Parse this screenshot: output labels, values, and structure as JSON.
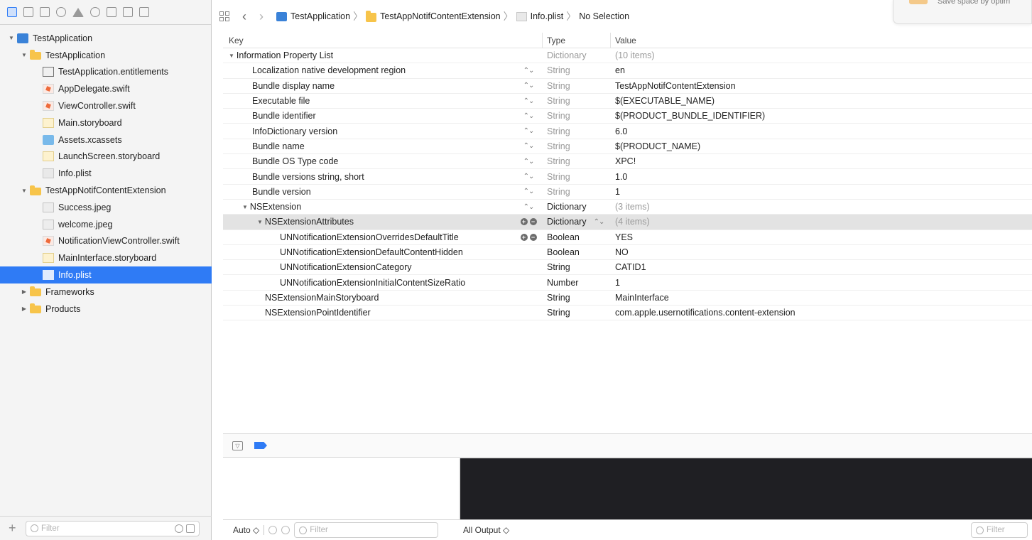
{
  "navigator": {
    "toolbar_icons": [
      "folder-icon",
      "source-control-icon",
      "symbol-icon",
      "find-icon",
      "issue-icon",
      "test-icon",
      "debug-icon",
      "breakpoint-icon",
      "report-icon"
    ],
    "filter_placeholder": "Filter",
    "tree": [
      {
        "label": "TestApplication",
        "icon": "project-icon"
      },
      {
        "label": "TestApplication",
        "icon": "folder-icon"
      },
      {
        "label": "TestApplication.entitlements",
        "icon": "entitlements-icon"
      },
      {
        "label": "AppDelegate.swift",
        "icon": "swift-file-icon"
      },
      {
        "label": "ViewController.swift",
        "icon": "swift-file-icon"
      },
      {
        "label": "Main.storyboard",
        "icon": "storyboard-icon"
      },
      {
        "label": "Assets.xcassets",
        "icon": "assets-icon"
      },
      {
        "label": "LaunchScreen.storyboard",
        "icon": "storyboard-icon"
      },
      {
        "label": "Info.plist",
        "icon": "plist-icon"
      },
      {
        "label": "TestAppNotifContentExtension",
        "icon": "folder-icon"
      },
      {
        "label": "Success.jpeg",
        "icon": "image-file-icon"
      },
      {
        "label": "welcome.jpeg",
        "icon": "image-file-icon"
      },
      {
        "label": "NotificationViewController.swift",
        "icon": "swift-file-icon"
      },
      {
        "label": "MainInterface.storyboard",
        "icon": "storyboard-icon"
      },
      {
        "label": "Info.plist",
        "icon": "plist-icon",
        "selected": true
      },
      {
        "label": "Frameworks",
        "icon": "folder-icon"
      },
      {
        "label": "Products",
        "icon": "folder-icon"
      }
    ]
  },
  "jumpbar": {
    "crumbs": [
      "TestApplication",
      "TestAppNotifContentExtension",
      "Info.plist",
      "No Selection"
    ]
  },
  "notification": {
    "text": "Save space by optim"
  },
  "plist": {
    "headers": {
      "key": "Key",
      "type": "Type",
      "value": "Value"
    },
    "rows": [
      {
        "key": "Information Property List",
        "type": "Dictionary",
        "value": "(10 items)"
      },
      {
        "key": "Localization native development region",
        "type": "String",
        "value": "en"
      },
      {
        "key": "Bundle display name",
        "type": "String",
        "value": "TestAppNotifContentExtension"
      },
      {
        "key": "Executable file",
        "type": "String",
        "value": "$(EXECUTABLE_NAME)"
      },
      {
        "key": "Bundle identifier",
        "type": "String",
        "value": "$(PRODUCT_BUNDLE_IDENTIFIER)"
      },
      {
        "key": "InfoDictionary version",
        "type": "String",
        "value": "6.0"
      },
      {
        "key": "Bundle name",
        "type": "String",
        "value": "$(PRODUCT_NAME)"
      },
      {
        "key": "Bundle OS Type code",
        "type": "String",
        "value": "XPC!"
      },
      {
        "key": "Bundle versions string, short",
        "type": "String",
        "value": "1.0"
      },
      {
        "key": "Bundle version",
        "type": "String",
        "value": "1"
      },
      {
        "key": "NSExtension",
        "type": "Dictionary",
        "value": "(3 items)"
      },
      {
        "key": "NSExtensionAttributes",
        "type": "Dictionary",
        "value": "(4 items)"
      },
      {
        "key": "UNNotificationExtensionOverridesDefaultTitle",
        "type": "Boolean",
        "value": "YES"
      },
      {
        "key": "UNNotificationExtensionDefaultContentHidden",
        "type": "Boolean",
        "value": "NO"
      },
      {
        "key": "UNNotificationExtensionCategory",
        "type": "String",
        "value": "CATID1"
      },
      {
        "key": "UNNotificationExtensionInitialContentSizeRatio",
        "type": "Number",
        "value": "1"
      },
      {
        "key": "NSExtensionMainStoryboard",
        "type": "String",
        "value": "MainInterface"
      },
      {
        "key": "NSExtensionPointIdentifier",
        "type": "String",
        "value": "com.apple.usernotifications.content-extension"
      }
    ]
  },
  "debug": {
    "auto_label": "Auto ◇",
    "filter_placeholder": "Filter",
    "output_label": "All Output ◇",
    "right_filter_placeholder": "Filter"
  },
  "colors": {
    "selection": "#2f7bf5",
    "console_bg": "#1f1f23"
  }
}
